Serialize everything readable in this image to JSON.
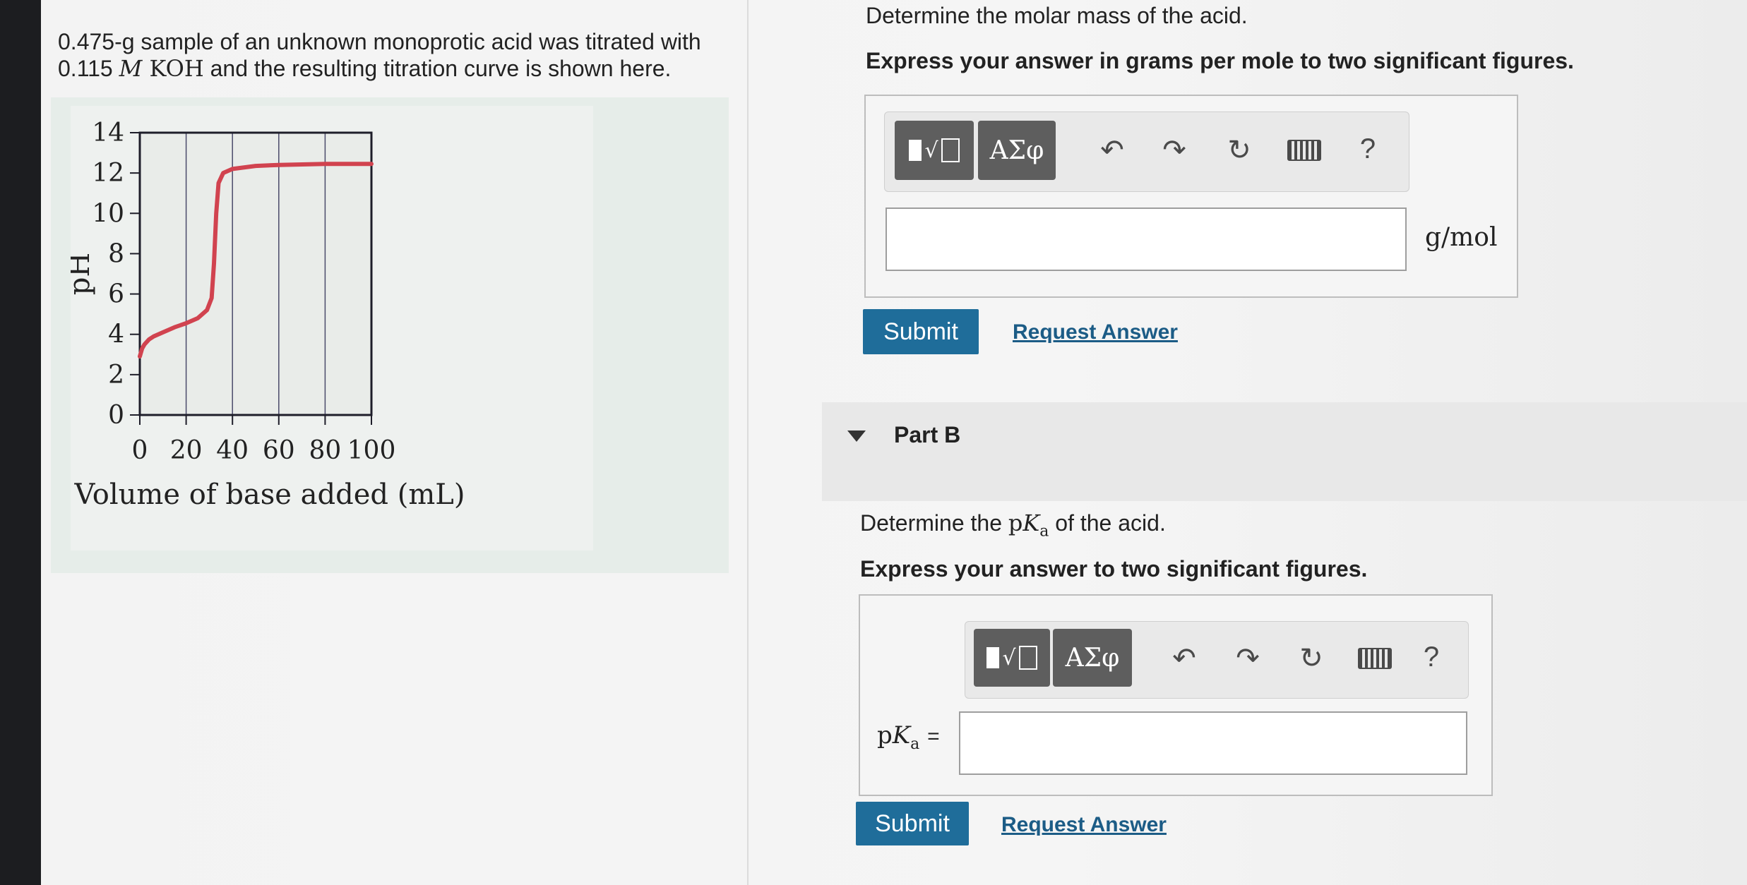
{
  "problem": {
    "line1_text": "0.475-g sample of an unknown monoprotic acid was titrated with",
    "line2_number": "0.115",
    "line2_unit_symbol": "M",
    "line2_reagent": "KOH",
    "line2_rest": "and the resulting titration curve is shown here."
  },
  "chart_data": {
    "type": "line",
    "xlabel": "Volume of base added (mL)",
    "ylabel": "pH",
    "xlim": [
      0,
      100
    ],
    "ylim": [
      0,
      14
    ],
    "x_ticks": [
      "0",
      "20",
      "40",
      "60",
      "80",
      "100"
    ],
    "y_ticks": [
      "0",
      "2",
      "4",
      "6",
      "8",
      "10",
      "12",
      "14"
    ],
    "vertical_grid_at": [
      20,
      40,
      60,
      80
    ],
    "series": [
      {
        "color": "#d1434f",
        "points": [
          [
            0,
            2.9
          ],
          [
            1,
            3.3
          ],
          [
            2,
            3.5
          ],
          [
            4,
            3.75
          ],
          [
            6,
            3.9
          ],
          [
            10,
            4.1
          ],
          [
            15,
            4.35
          ],
          [
            20,
            4.55
          ],
          [
            25,
            4.8
          ],
          [
            29,
            5.2
          ],
          [
            31,
            5.8
          ],
          [
            32,
            7.5
          ],
          [
            33,
            10.0
          ],
          [
            34,
            11.5
          ],
          [
            36,
            12.0
          ],
          [
            40,
            12.2
          ],
          [
            50,
            12.35
          ],
          [
            60,
            12.4
          ],
          [
            80,
            12.45
          ],
          [
            100,
            12.45
          ]
        ]
      }
    ]
  },
  "part_a": {
    "prompt": "Determine the molar mass of the acid.",
    "instruction": "Express your answer in grams per mole to two significant figures.",
    "toolbar": {
      "templates_icon": "templates-icon",
      "symbols_label": "ΑΣφ",
      "undo_icon": "undo-icon",
      "redo_icon": "redo-icon",
      "reset_icon": "reset-icon",
      "keyboard_icon": "keyboard-icon",
      "help_label": "?"
    },
    "input_value": "",
    "unit": "g/mol",
    "submit_label": "Submit",
    "request_label": "Request Answer"
  },
  "part_b": {
    "title": "Part B",
    "prompt_prefix": "Determine the",
    "prompt_suffix": "of the acid.",
    "instruction": "Express your answer to two significant figures.",
    "toolbar": {
      "templates_icon": "templates-icon",
      "symbols_label": "ΑΣφ",
      "undo_icon": "undo-icon",
      "redo_icon": "redo-icon",
      "reset_icon": "reset-icon",
      "keyboard_icon": "keyboard-icon",
      "help_label": "?"
    },
    "input_label": "= ",
    "input_value": "",
    "submit_label": "Submit",
    "request_label": "Request Answer"
  },
  "colors": {
    "accent": "#1f6d9a",
    "link": "#1c5c86",
    "curve": "#d1434f",
    "toolbar_button": "#5e5e5e"
  }
}
